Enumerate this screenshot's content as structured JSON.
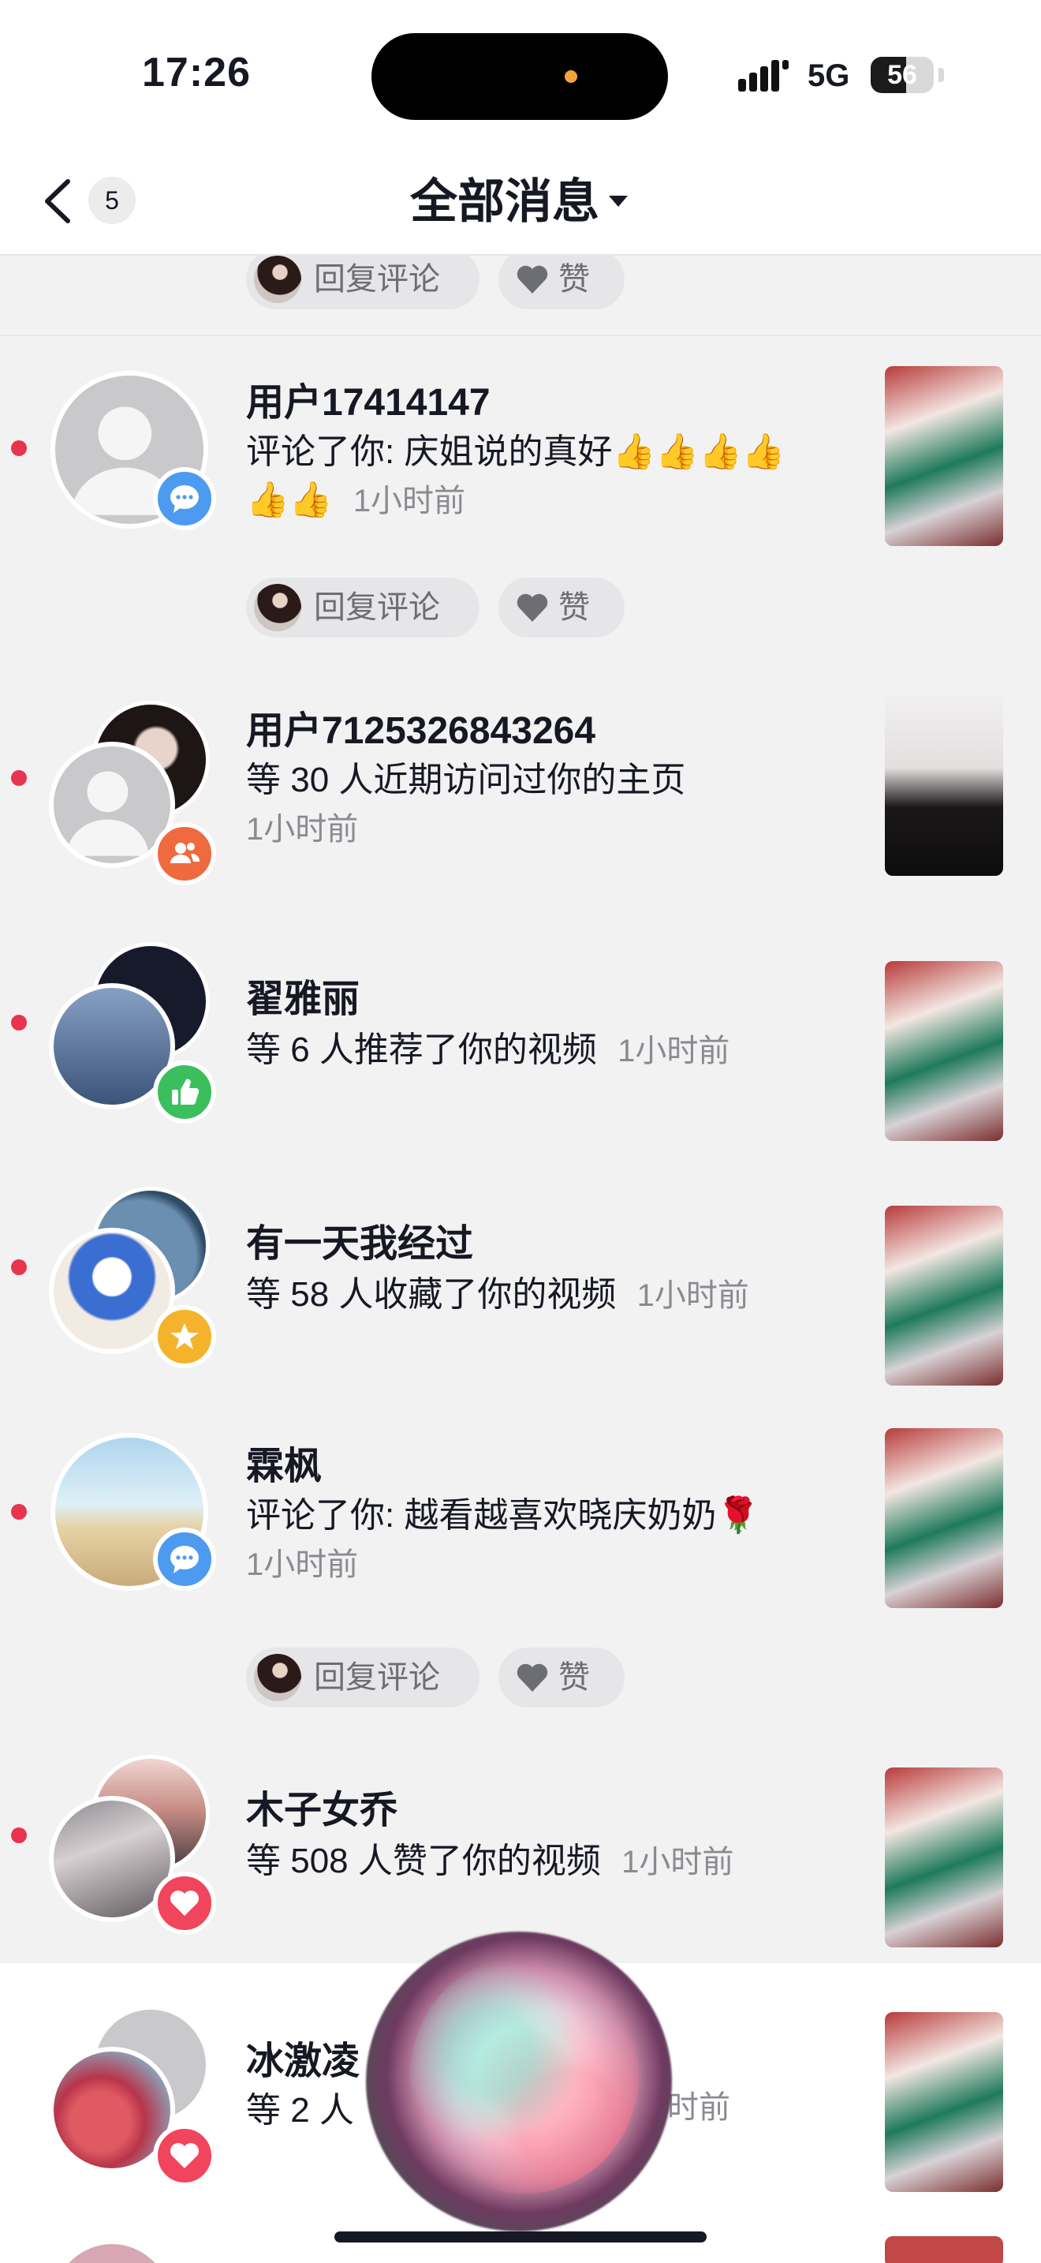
{
  "status_bar": {
    "time": "17:26",
    "network": "5G",
    "battery": "56",
    "battery_level": 0.56
  },
  "nav": {
    "back_count": "5",
    "title": "全部消息"
  },
  "actions": {
    "reply_label": "回复评论",
    "like_label": "赞"
  },
  "notifications": [
    {
      "name": "用户17414147",
      "text": "评论了你: 庆姐说的真好👍👍👍👍",
      "text2": "👍👍",
      "time": "1小时前",
      "type_icon": "comment-icon",
      "unread": true
    },
    {
      "name": "用户7125326843264",
      "text": "等 30 人近期访问过你的主页",
      "time": "1小时前",
      "type_icon": "visitors-icon",
      "unread": true
    },
    {
      "name": "翟雅丽",
      "text": "等 6 人推荐了你的视频",
      "time": "1小时前",
      "type_icon": "thumbs-up-icon",
      "unread": true
    },
    {
      "name": "有一天我经过",
      "text": "等 58 人收藏了你的视频",
      "time": "1小时前",
      "type_icon": "star-icon",
      "unread": true
    },
    {
      "name": "霖枫",
      "text": "评论了你: 越看越喜欢晓庆奶奶🌹",
      "time": "1小时前",
      "type_icon": "comment-icon",
      "unread": true
    },
    {
      "name": "木子女乔",
      "text": "等 508 人赞了你的视频",
      "time": "1小时前",
      "type_icon": "heart-icon",
      "unread": true
    },
    {
      "name": "冰激凌",
      "text": "等 2 人",
      "time": "时前",
      "type_icon": "heart-icon",
      "unread": false
    }
  ],
  "colors": {
    "comment": "#4d9bf0",
    "visitors": "#ef6a3e",
    "thumbs_up": "#3bbf5c",
    "star": "#f4b32b",
    "heart": "#f0455c",
    "unread_dot": "#e8344e"
  }
}
